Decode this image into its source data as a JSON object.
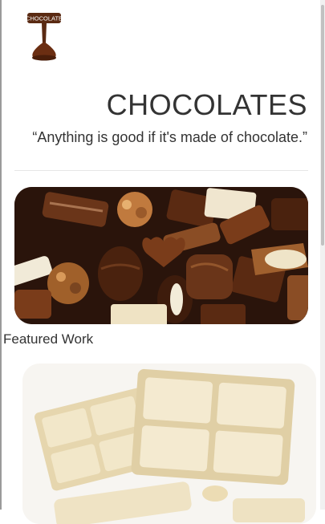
{
  "logo": {
    "text": "CHOCOLATE",
    "icon": "chocolate-drip-logo"
  },
  "header": {
    "title": "CHOCOLATES",
    "tagline": "“Anything is good if it's made of chocolate.”"
  },
  "featured": {
    "title": "Featured Work"
  },
  "colors": {
    "dark_chocolate": "#3a1c0e",
    "milk_chocolate": "#8a5231",
    "white_chocolate": "#efe3c4",
    "text": "#333333"
  }
}
